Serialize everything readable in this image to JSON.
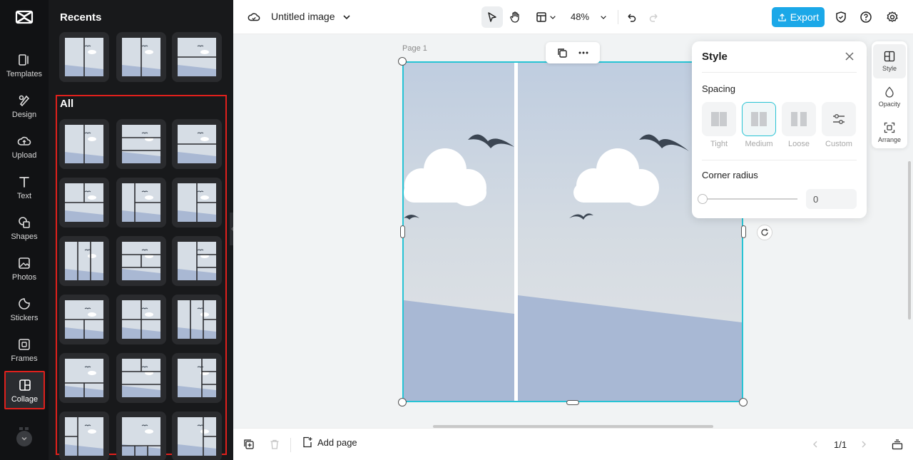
{
  "rail": {
    "items": [
      {
        "label": "Templates",
        "icon": "templates-icon"
      },
      {
        "label": "Design",
        "icon": "design-icon"
      },
      {
        "label": "Upload",
        "icon": "upload-icon"
      },
      {
        "label": "Text",
        "icon": "text-icon"
      },
      {
        "label": "Shapes",
        "icon": "shapes-icon"
      },
      {
        "label": "Photos",
        "icon": "photos-icon"
      },
      {
        "label": "Stickers",
        "icon": "stickers-icon"
      },
      {
        "label": "Frames",
        "icon": "frames-icon"
      },
      {
        "label": "Collage",
        "icon": "collage-icon",
        "active": true
      }
    ]
  },
  "panel": {
    "recents_title": "Recents",
    "all_title": "All"
  },
  "header": {
    "doc_title": "Untitled image",
    "zoom": "48%",
    "export_label": "Export",
    "accent": "#1ba8e8"
  },
  "canvas": {
    "page_label": "Page 1",
    "selection_color": "#27c3d4"
  },
  "style_panel": {
    "title": "Style",
    "spacing_label": "Spacing",
    "spacing_options": [
      "Tight",
      "Medium",
      "Loose",
      "Custom"
    ],
    "selected_spacing": "Medium",
    "corner_radius_label": "Corner radius",
    "corner_radius_value": "0"
  },
  "right_tools": {
    "style": "Style",
    "opacity": "Opacity",
    "arrange": "Arrange"
  },
  "footer": {
    "add_page": "Add page",
    "page_count": "1/1"
  }
}
